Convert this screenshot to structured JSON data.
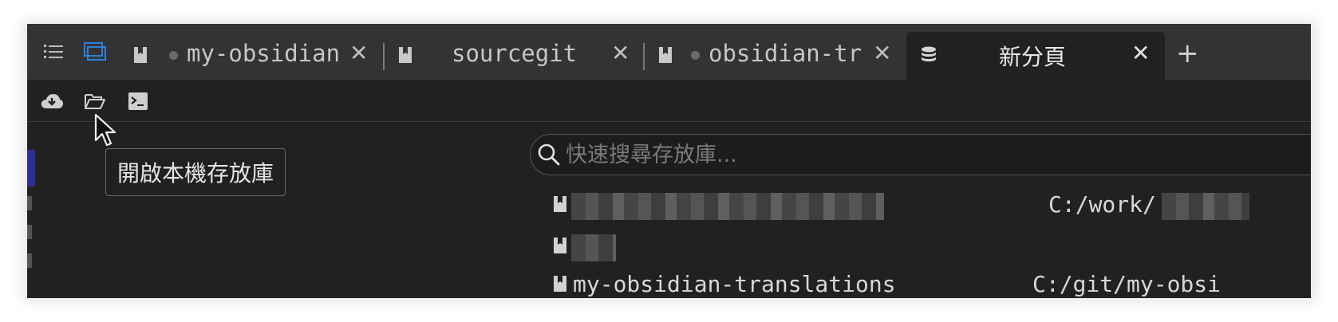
{
  "tabbar": {
    "tabs": [
      {
        "title": "my-obsidian",
        "modified": true,
        "active": false
      },
      {
        "title": "sourcegit",
        "modified": false,
        "active": false
      },
      {
        "title": "obsidian-tr",
        "modified": true,
        "active": false
      },
      {
        "title": "新分頁",
        "modified": false,
        "active": true
      }
    ],
    "close_glyph": "✕",
    "add_glyph": "+"
  },
  "toolbar": {
    "tools": [
      "cloud-download-icon",
      "folder-open-icon",
      "terminal-icon"
    ]
  },
  "tooltip": {
    "text": "開啟本機存放庫"
  },
  "search": {
    "placeholder": "快速搜尋存放庫...",
    "value": ""
  },
  "repos": [
    {
      "name": "",
      "path": "C:/work/"
    },
    {
      "name": "",
      "path": ""
    },
    {
      "name": "my-obsidian-translations",
      "path": "C:/git/my-obsi"
    }
  ],
  "colors": {
    "accent_blue": "#2f7fd6",
    "tab_bar": "#333336",
    "content_bg": "#212121"
  }
}
